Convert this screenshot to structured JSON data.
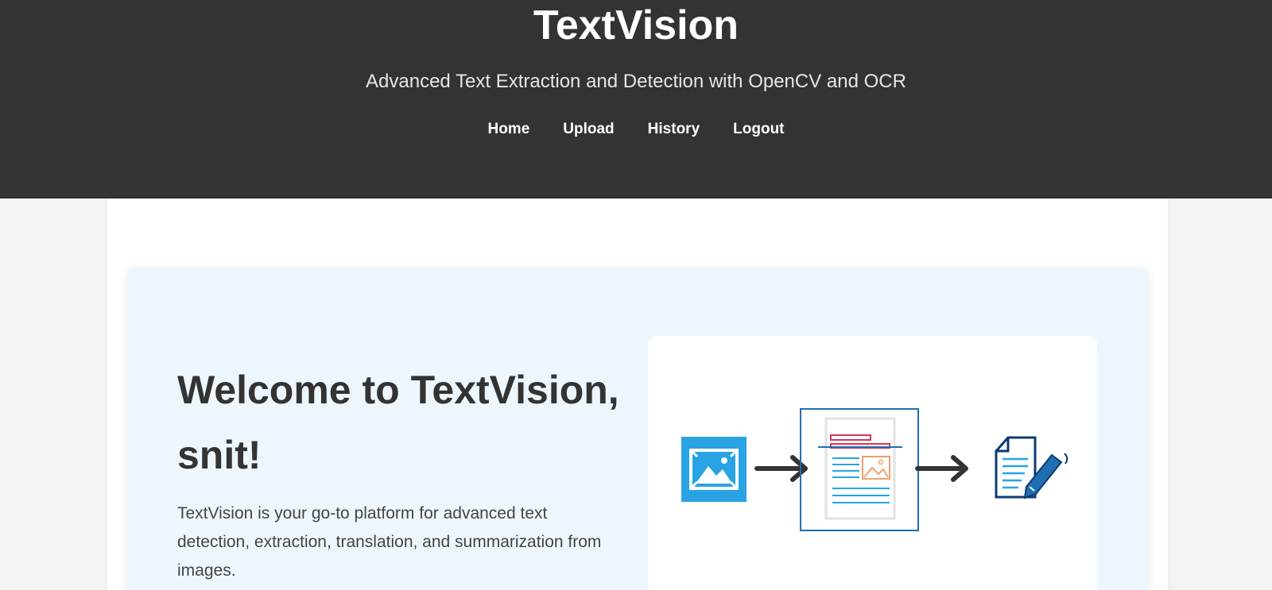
{
  "header": {
    "title": "TextVision",
    "tagline": "Advanced Text Extraction and Detection with OpenCV and OCR"
  },
  "nav": {
    "items": [
      {
        "label": "Home"
      },
      {
        "label": "Upload"
      },
      {
        "label": "History"
      },
      {
        "label": "Logout"
      }
    ]
  },
  "hero": {
    "title_line1": "Welcome to TextVision,",
    "title_line2": "snit!",
    "description": "TextVision is your go-to platform for advanced text detection, extraction, translation, and summarization from images."
  },
  "illustration": {
    "icons": [
      "image-icon",
      "arrow-right-icon",
      "document-scan-icon",
      "arrow-right-icon",
      "document-edit-icon"
    ]
  },
  "colors": {
    "header_bg": "#333333",
    "accent_blue": "#29a3e3",
    "dark_blue": "#0d3b73",
    "hero_bg": "#eef6fd"
  }
}
